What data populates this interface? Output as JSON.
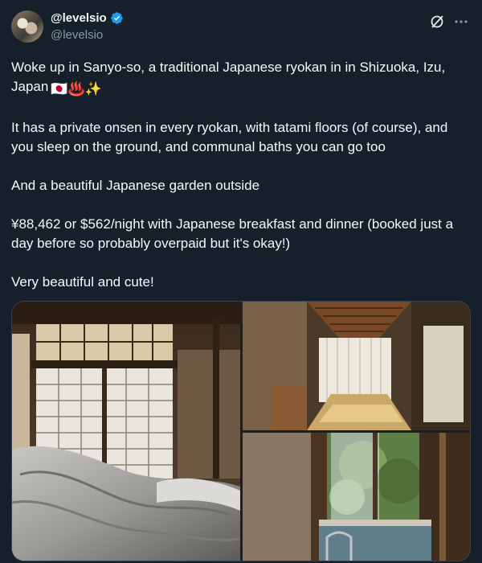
{
  "author": {
    "display_name": "@levelsio",
    "handle": "@levelsio"
  },
  "colors": {
    "background": "#15202b",
    "text": "#f7f9f9",
    "secondary_text": "#8b98a5",
    "verified": "#1d9bf0",
    "border": "#38444d"
  },
  "icons": {
    "verified": "verified-badge-icon",
    "grok": "grok-icon",
    "more": "more-options-icon"
  },
  "tweet": {
    "line1": "Woke up in Sanyo-so, a traditional Japanese ryokan in in Shizuoka, Izu, Japan",
    "line1_emojis": "🇯🇵♨️✨",
    "para2": "It has a private onsen in every ryokan, with tatami floors (of course), and you sleep on the ground, and communal baths you can go too",
    "para3": "And a beautiful Japanese garden outside",
    "para4": "¥88,462 or $562/night with Japanese breakfast and dinner (booked just a day before so probably overpaid but it's okay!)",
    "para5": "Very beautiful and cute!"
  }
}
